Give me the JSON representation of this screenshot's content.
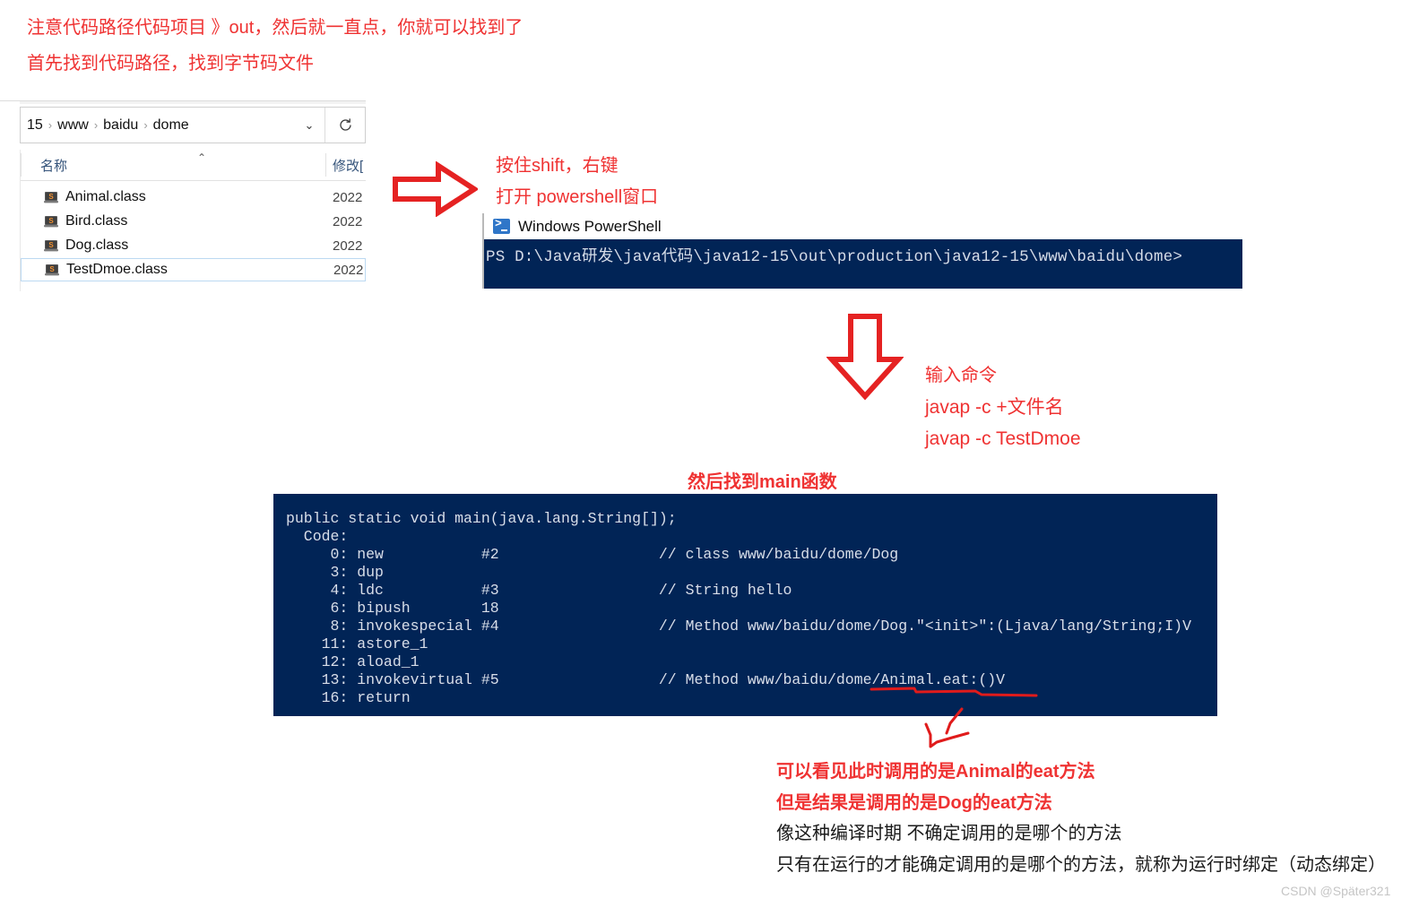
{
  "annotations": {
    "top_line1": "注意代码路径代码项目 》out，然后就一直点，你就可以找到了",
    "top_line2": "首先找到代码路径，找到字节码文件",
    "shift_line1": "按住shift，右键",
    "shift_line2": "打开 powershell窗口",
    "cmd_line1": "输入命令",
    "cmd_line2": "javap -c +文件名",
    "cmd_line3": "javap -c TestDmoe",
    "find_main": "然后找到main函数",
    "concl_red1": "可以看见此时调用的是Animal的eat方法",
    "concl_red2": "但是结果是调用的是Dog的eat方法",
    "concl_black1": "像这种编译时期 不确定调用的是哪个的方法",
    "concl_black2": "只有在运行的才能确定调用的是哪个的方法，就称为运行时绑定（动态绑定）"
  },
  "explorer": {
    "breadcrumb": [
      "15",
      "www",
      "baidu",
      "dome"
    ],
    "breadcrumb_separator": "›",
    "chevron": "⌄",
    "refresh_icon": "refresh-icon",
    "columns": {
      "name": "名称",
      "date": "修改[",
      "sort_caret": "⌃"
    },
    "files": [
      {
        "name": "Animal.class",
        "date": "2022",
        "icon": "java-class-icon",
        "selected": false
      },
      {
        "name": "Bird.class",
        "date": "2022",
        "icon": "java-class-icon",
        "selected": false
      },
      {
        "name": "Dog.class",
        "date": "2022",
        "icon": "java-class-icon",
        "selected": false
      },
      {
        "name": "TestDmoe.class",
        "date": "2022",
        "icon": "java-class-icon",
        "selected": true
      }
    ]
  },
  "powershell": {
    "title": "Windows PowerShell",
    "icon": "powershell-icon",
    "prompt_line": "PS D:\\Java研发\\java代码\\java12-15\\out\\production\\java12-15\\www\\baidu\\dome>"
  },
  "bytecode": {
    "text": "public static void main(java.lang.String[]);\n  Code:\n     0: new           #2                  // class www/baidu/dome/Dog\n     3: dup\n     4: ldc           #3                  // String hello\n     6: bipush        18\n     8: invokespecial #4                  // Method www/baidu/dome/Dog.\"<init>\":(Ljava/lang/String;I)V\n    11: astore_1\n    12: aload_1\n    13: invokevirtual #5                  // Method www/baidu/dome/Animal.eat:()V\n    16: return"
  },
  "watermark": "CSDN @Später321",
  "colors": {
    "annotation_red": "#ef3232",
    "console_bg": "#012456",
    "console_fg": "#d9dee9",
    "arrow_red": "#e52222",
    "scribble_red": "#e01b1b",
    "breadcrumb_text": "#101010",
    "column_header": "#34537a",
    "watermark": "#c5c5c5"
  }
}
